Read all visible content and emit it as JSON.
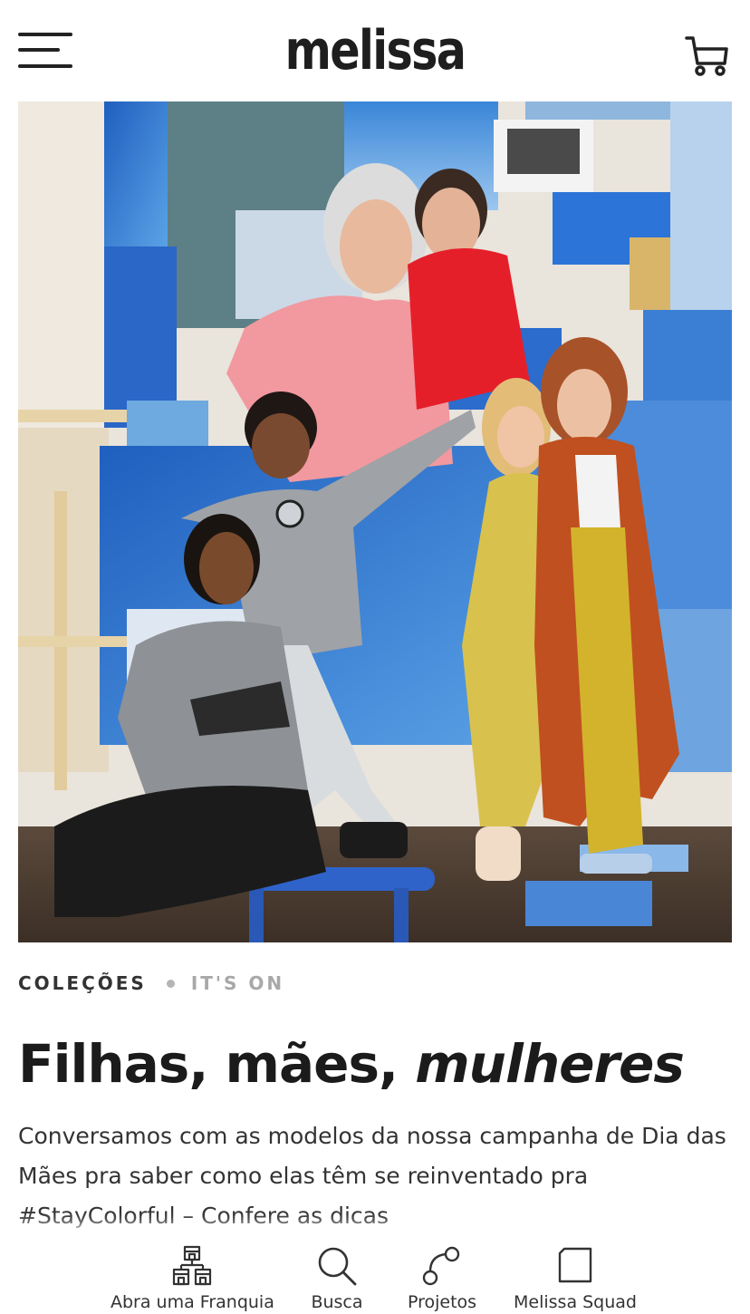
{
  "header": {
    "logo": "melissa",
    "menu_icon": "hamburger-menu-icon",
    "cart_icon": "shopping-cart-icon"
  },
  "hero": {
    "image": "campaign-photo"
  },
  "article": {
    "category": "COLEÇÕES",
    "tag": "IT'S ON",
    "title_regular": "Filhas, mães, ",
    "title_italic": "mulheres",
    "description": "Conversamos com as modelos da nossa campanha de Dia das Mães pra saber como elas têm se reinventado pra #StayColorful – Confere as dicas"
  },
  "bottom_nav": {
    "items": [
      {
        "label": "Abra uma Franquia",
        "icon": "franchise-stores-icon"
      },
      {
        "label": "Busca",
        "icon": "search-icon"
      },
      {
        "label": "Projetos",
        "icon": "projects-icon"
      },
      {
        "label": "Melissa Squad",
        "icon": "squad-icon"
      }
    ]
  },
  "colors": {
    "text": "#1b1b1b",
    "muted": "#a8a8a8",
    "accent_blue": "#2f6fd6"
  }
}
